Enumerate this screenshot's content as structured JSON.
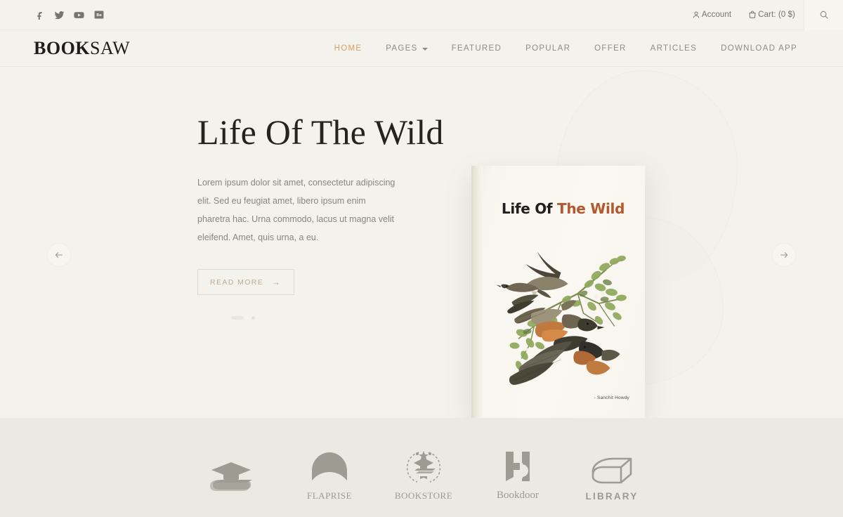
{
  "topbar": {
    "social": [
      {
        "name": "facebook-icon",
        "label": "Facebook"
      },
      {
        "name": "twitter-icon",
        "label": "Twitter"
      },
      {
        "name": "youtube-icon",
        "label": "YouTube"
      },
      {
        "name": "behance-icon",
        "label": "Behance"
      }
    ],
    "account_label": "Account",
    "cart_label": "Cart: (0 $)",
    "search_icon": "search-icon"
  },
  "header": {
    "logo_bold": "BOOK",
    "logo_light": "SAW",
    "nav": [
      {
        "label": "HOME",
        "active": true,
        "dropdown": false
      },
      {
        "label": "PAGES",
        "active": false,
        "dropdown": true
      },
      {
        "label": "FEATURED",
        "active": false,
        "dropdown": false
      },
      {
        "label": "POPULAR",
        "active": false,
        "dropdown": false
      },
      {
        "label": "OFFER",
        "active": false,
        "dropdown": false
      },
      {
        "label": "ARTICLES",
        "active": false,
        "dropdown": false
      },
      {
        "label": "DOWNLOAD APP",
        "active": false,
        "dropdown": false
      }
    ],
    "accent_color": "#d9a066"
  },
  "hero": {
    "title": "Life Of The Wild",
    "description": "Lorem ipsum dolor sit amet, consectetur adipiscing elit. Sed eu feugiat amet, libero ipsum enim pharetra hac. Urna commodo, lacus ut magna velit eleifend. Amet, quis urna, a eu.",
    "cta_label": "READ MORE",
    "cta_arrow": "→",
    "prev_arrow": "←",
    "next_arrow": "→",
    "book": {
      "title_dark": "Life Of ",
      "title_rust": "The Wild",
      "author": "- Sanchit Howdy",
      "rust_color": "#b5582c"
    },
    "background_color": "#f3f2ec"
  },
  "partners": {
    "background_color": "#ebeae2",
    "items": [
      {
        "icon": "graduation-cap-book-icon",
        "label": ""
      },
      {
        "icon": "open-book-arch-icon",
        "label": "FLAPRISE"
      },
      {
        "icon": "laurel-crest-icon",
        "label": "BOOKSTORE"
      },
      {
        "icon": "letter-h-book-icon",
        "label": "Bookdoor"
      },
      {
        "icon": "book-outline-icon",
        "label": "LIBRARY"
      }
    ]
  }
}
